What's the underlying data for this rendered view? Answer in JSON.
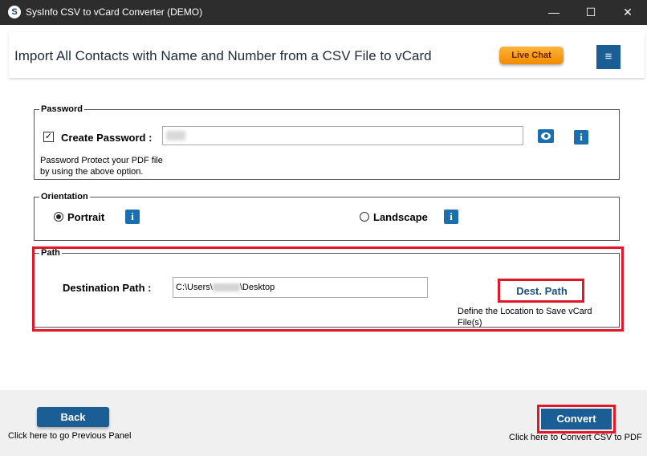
{
  "window": {
    "app_icon_letter": "S",
    "title": "SysInfo CSV to vCard Converter (DEMO)",
    "min_symbol": "—",
    "max_symbol": "☐",
    "close_symbol": "✕"
  },
  "header": {
    "title": "Import All Contacts with Name and Number from a CSV File to vCard",
    "live_chat_label": "Live Chat",
    "menu_symbol": "≡"
  },
  "password": {
    "legend": "Password",
    "checkbox_checked": true,
    "checkbox_symbol": "✓",
    "create_label": "Create Password :",
    "help_line1": "Password Protect your PDF file",
    "help_line2": "by using the above option.",
    "info_symbol": "i"
  },
  "orientation": {
    "legend": "Orientation",
    "portrait_label": "Portrait",
    "landscape_label": "Landscape",
    "selected": "Portrait",
    "info_symbol": "i"
  },
  "path": {
    "legend": "Path",
    "dest_label": "Destination Path :",
    "dest_value_prefix": "C:\\Users\\",
    "dest_value_suffix": "\\Desktop",
    "dest_button": "Dest. Path",
    "dest_hint": "Define the Location to Save vCard File(s)"
  },
  "footer": {
    "back_label": "Back",
    "back_hint": "Click here to go Previous Panel",
    "convert_label": "Convert",
    "convert_hint": "Click here to Convert CSV to PDF"
  },
  "colors": {
    "accent_blue": "#1b5e95",
    "highlight_red": "#e0182a",
    "live_chat_orange": "#f08b00",
    "titlebar": "#2d2d2d"
  },
  "icons": [
    "app-logo-icon",
    "minimize-icon",
    "maximize-icon",
    "close-icon",
    "hamburger-menu-icon",
    "eye-icon",
    "info-icon",
    "check-icon"
  ]
}
